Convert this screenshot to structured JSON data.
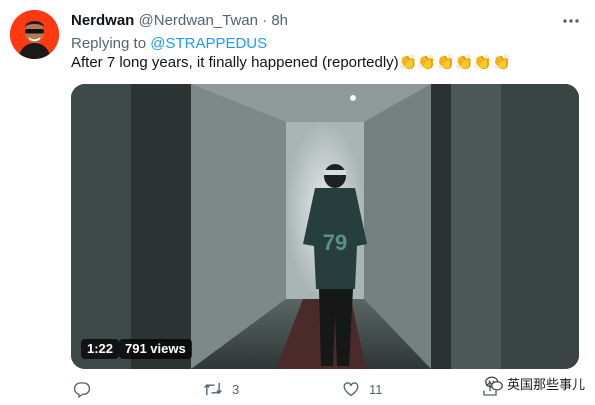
{
  "tweet": {
    "display_name": "Nerdwan",
    "handle": "@Nerdwan_Twan",
    "separator": "·",
    "time": "8h",
    "replying_to_label": "Replying to",
    "replying_to_mention": "@STRAPPEDUS",
    "text": "After 7 long years, it finally happened (reportedly)",
    "emoji": "👏👏👏👏👏👏"
  },
  "video": {
    "duration": "1:22",
    "views": "791 views",
    "jersey_number": "79"
  },
  "actions": {
    "reply_count": "",
    "retweet_count": "3",
    "like_count": "11"
  },
  "watermark": {
    "text": "英国那些事儿"
  },
  "colors": {
    "accent": "#1d9bf0",
    "secondary_text": "#536471",
    "avatar_bg": "#ff3a13"
  },
  "icons": {
    "more": "more-dots-icon",
    "reply": "reply-bubble-icon",
    "retweet": "retweet-arrows-icon",
    "like": "heart-icon",
    "share": "share-upload-icon",
    "watermark": "wechat-icon"
  }
}
